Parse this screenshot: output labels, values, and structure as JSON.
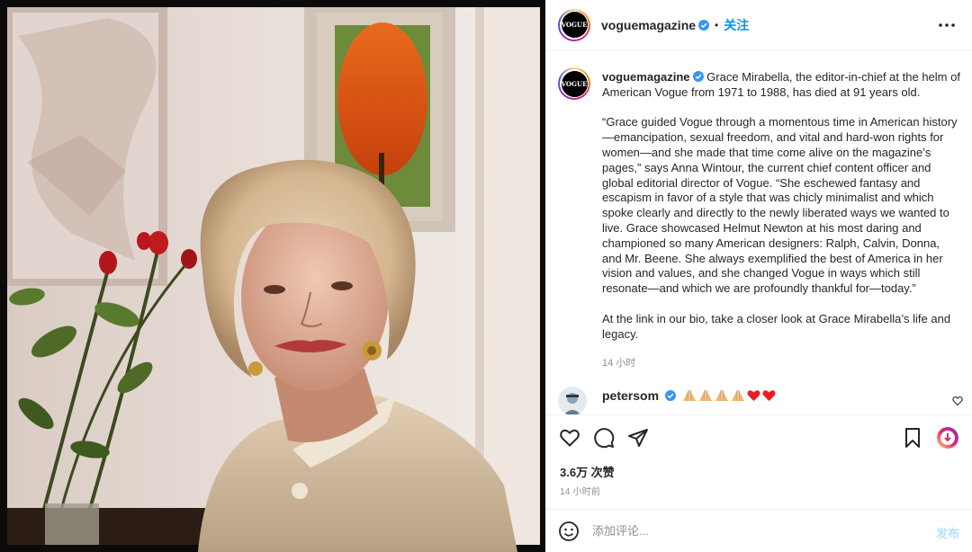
{
  "post": {
    "account": "voguemagazine",
    "avatar_text": "VOGUE",
    "follow_label": "关注",
    "dot": "•",
    "caption": {
      "username": "voguemagazine",
      "p1": "Grace Mirabella, the editor-in-chief at the helm of American Vogue from 1971 to 1988, has died at 91 years old.",
      "p2": "“Grace guided Vogue through a momentous time in American history—emancipation, sexual freedom, and vital and hard-won rights for women—and she made that time come alive on the magazine’s pages,” says Anna Wintour, the current chief content officer and global editorial director of Vogue. “She eschewed fantasy and escapism in favor of a style that was chicly minimalist and which spoke clearly and directly to the newly liberated ways we wanted to live. Grace showcased Helmut Newton at his most daring and championed so many American designers: Ralph, Calvin, Donna, and Mr. Beene. She always exemplified the best of America in her vision and values, and she changed Vogue in ways which still resonate—and which we are profoundly thankful for—today.”",
      "p3": "At the link in our bio, take a closer look at Grace Mirabella’s life and legacy.",
      "time": "14 小时"
    },
    "comment": {
      "username": "petersom",
      "emojis": [
        "pray",
        "pray",
        "pray",
        "pray",
        "red-heart",
        "red-heart"
      ]
    },
    "likes": "3.6万 次赞",
    "posted_time": "14 小时前",
    "add_comment_placeholder": "添加评论...",
    "post_button": "发布"
  },
  "colors": {
    "accent": "#0095f6",
    "post_disabled": "#b2dffc",
    "verified": "#3897f0",
    "heart": "#ed1c24"
  },
  "icons": [
    "more-icon",
    "verified-icon",
    "like-icon",
    "comment-icon",
    "share-icon",
    "save-icon",
    "reel-audio-icon",
    "emoji-icon",
    "comment-like-icon"
  ]
}
